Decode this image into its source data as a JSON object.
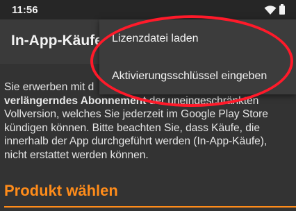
{
  "status_bar": {
    "time": "11:56",
    "icons": [
      "wifi-icon",
      "battery-icon"
    ]
  },
  "app_bar": {
    "title": "In-App-Käufe"
  },
  "content": {
    "desc_before": "Sie erwerben mit d",
    "desc_bold": "verlängerndes Abonnement",
    "desc_after": " der uneingeschränkten Vollversion, welches Sie jederzeit im Google Play Store kündigen können. Bitte beachten Sie, dass Käufe, die innerhalb der App durchgeführt werden (In-App-Käufe), nicht erstattet werden können.",
    "section_title": "Produkt wählen"
  },
  "menu": {
    "items": [
      {
        "label": "Lizenzdatei laden"
      },
      {
        "label": "Aktivierungsschlüssel eingeben"
      }
    ]
  },
  "colors": {
    "accent": "#ff8c1a",
    "annotation": "#ff1a2a"
  }
}
